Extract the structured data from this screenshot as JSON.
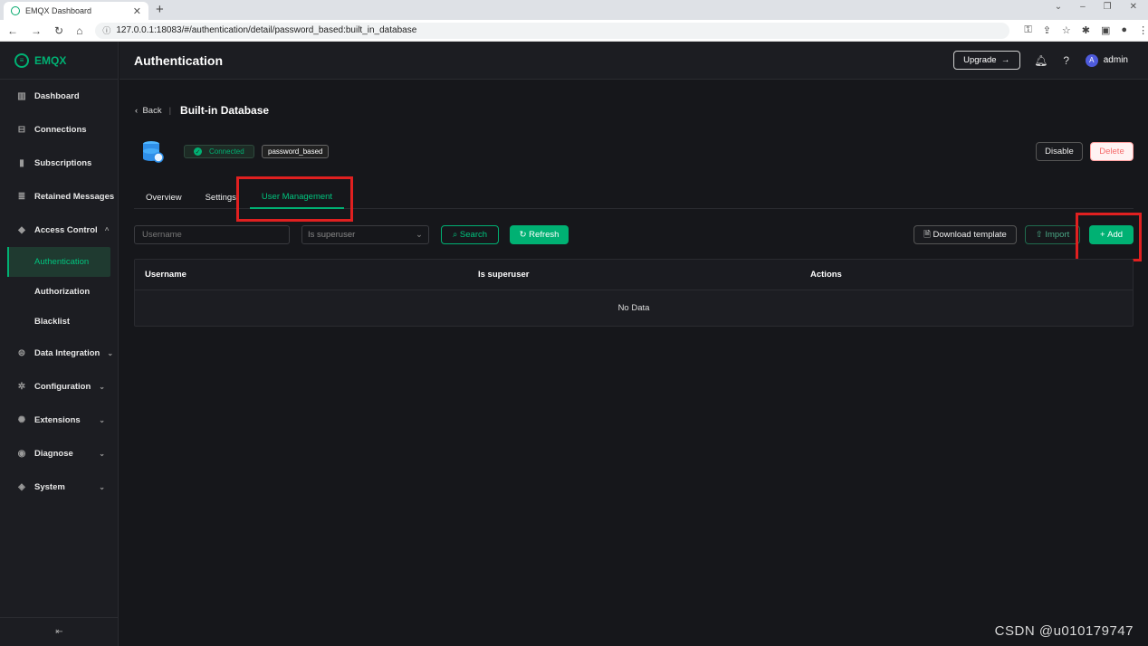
{
  "browser": {
    "tab_title": "EMQX Dashboard",
    "tab_close": "✕",
    "new_tab": "+",
    "url": "127.0.0.1:18083/#/authentication/detail/password_based:built_in_database"
  },
  "sidebar": {
    "logo": "EMQX",
    "items": [
      {
        "label": "Dashboard",
        "icon": "dashboard-icon"
      },
      {
        "label": "Connections",
        "icon": "connections-icon"
      },
      {
        "label": "Subscriptions",
        "icon": "subscriptions-icon"
      },
      {
        "label": "Retained Messages",
        "icon": "retained-icon"
      },
      {
        "label": "Access Control",
        "icon": "shield-icon"
      },
      {
        "label": "Authentication"
      },
      {
        "label": "Authorization"
      },
      {
        "label": "Blacklist"
      },
      {
        "label": "Data Integration",
        "icon": "integration-icon"
      },
      {
        "label": "Configuration",
        "icon": "gear-icon"
      },
      {
        "label": "Extensions",
        "icon": "extensions-icon"
      },
      {
        "label": "Diagnose",
        "icon": "diagnose-icon"
      },
      {
        "label": "System",
        "icon": "system-icon"
      }
    ]
  },
  "header": {
    "title": "Authentication",
    "upgrade_label": "Upgrade",
    "avatar_letter": "A",
    "username": "admin"
  },
  "page": {
    "back_label": "Back",
    "title": "Built-in Database",
    "status_tag": "Connected",
    "mechanism_tag": "password_based",
    "disable_label": "Disable",
    "delete_label": "Delete",
    "tabs": [
      {
        "label": "Overview"
      },
      {
        "label": "Settings"
      },
      {
        "label": "User Management",
        "active": true
      }
    ],
    "filters": {
      "username_placeholder": "Username",
      "superuser_placeholder": "Is superuser",
      "search_label": "Search",
      "refresh_label": "Refresh",
      "download_label": "Download template",
      "import_label": "Import",
      "add_label": "Add"
    },
    "table": {
      "columns": [
        "Username",
        "Is superuser",
        "Actions"
      ],
      "rows": [],
      "empty_text": "No Data"
    }
  },
  "watermark": "CSDN @u010179747",
  "colors": {
    "accent": "#00b173",
    "highlight": "#e02020",
    "danger": "#f56c6c",
    "background": "#16171b"
  }
}
